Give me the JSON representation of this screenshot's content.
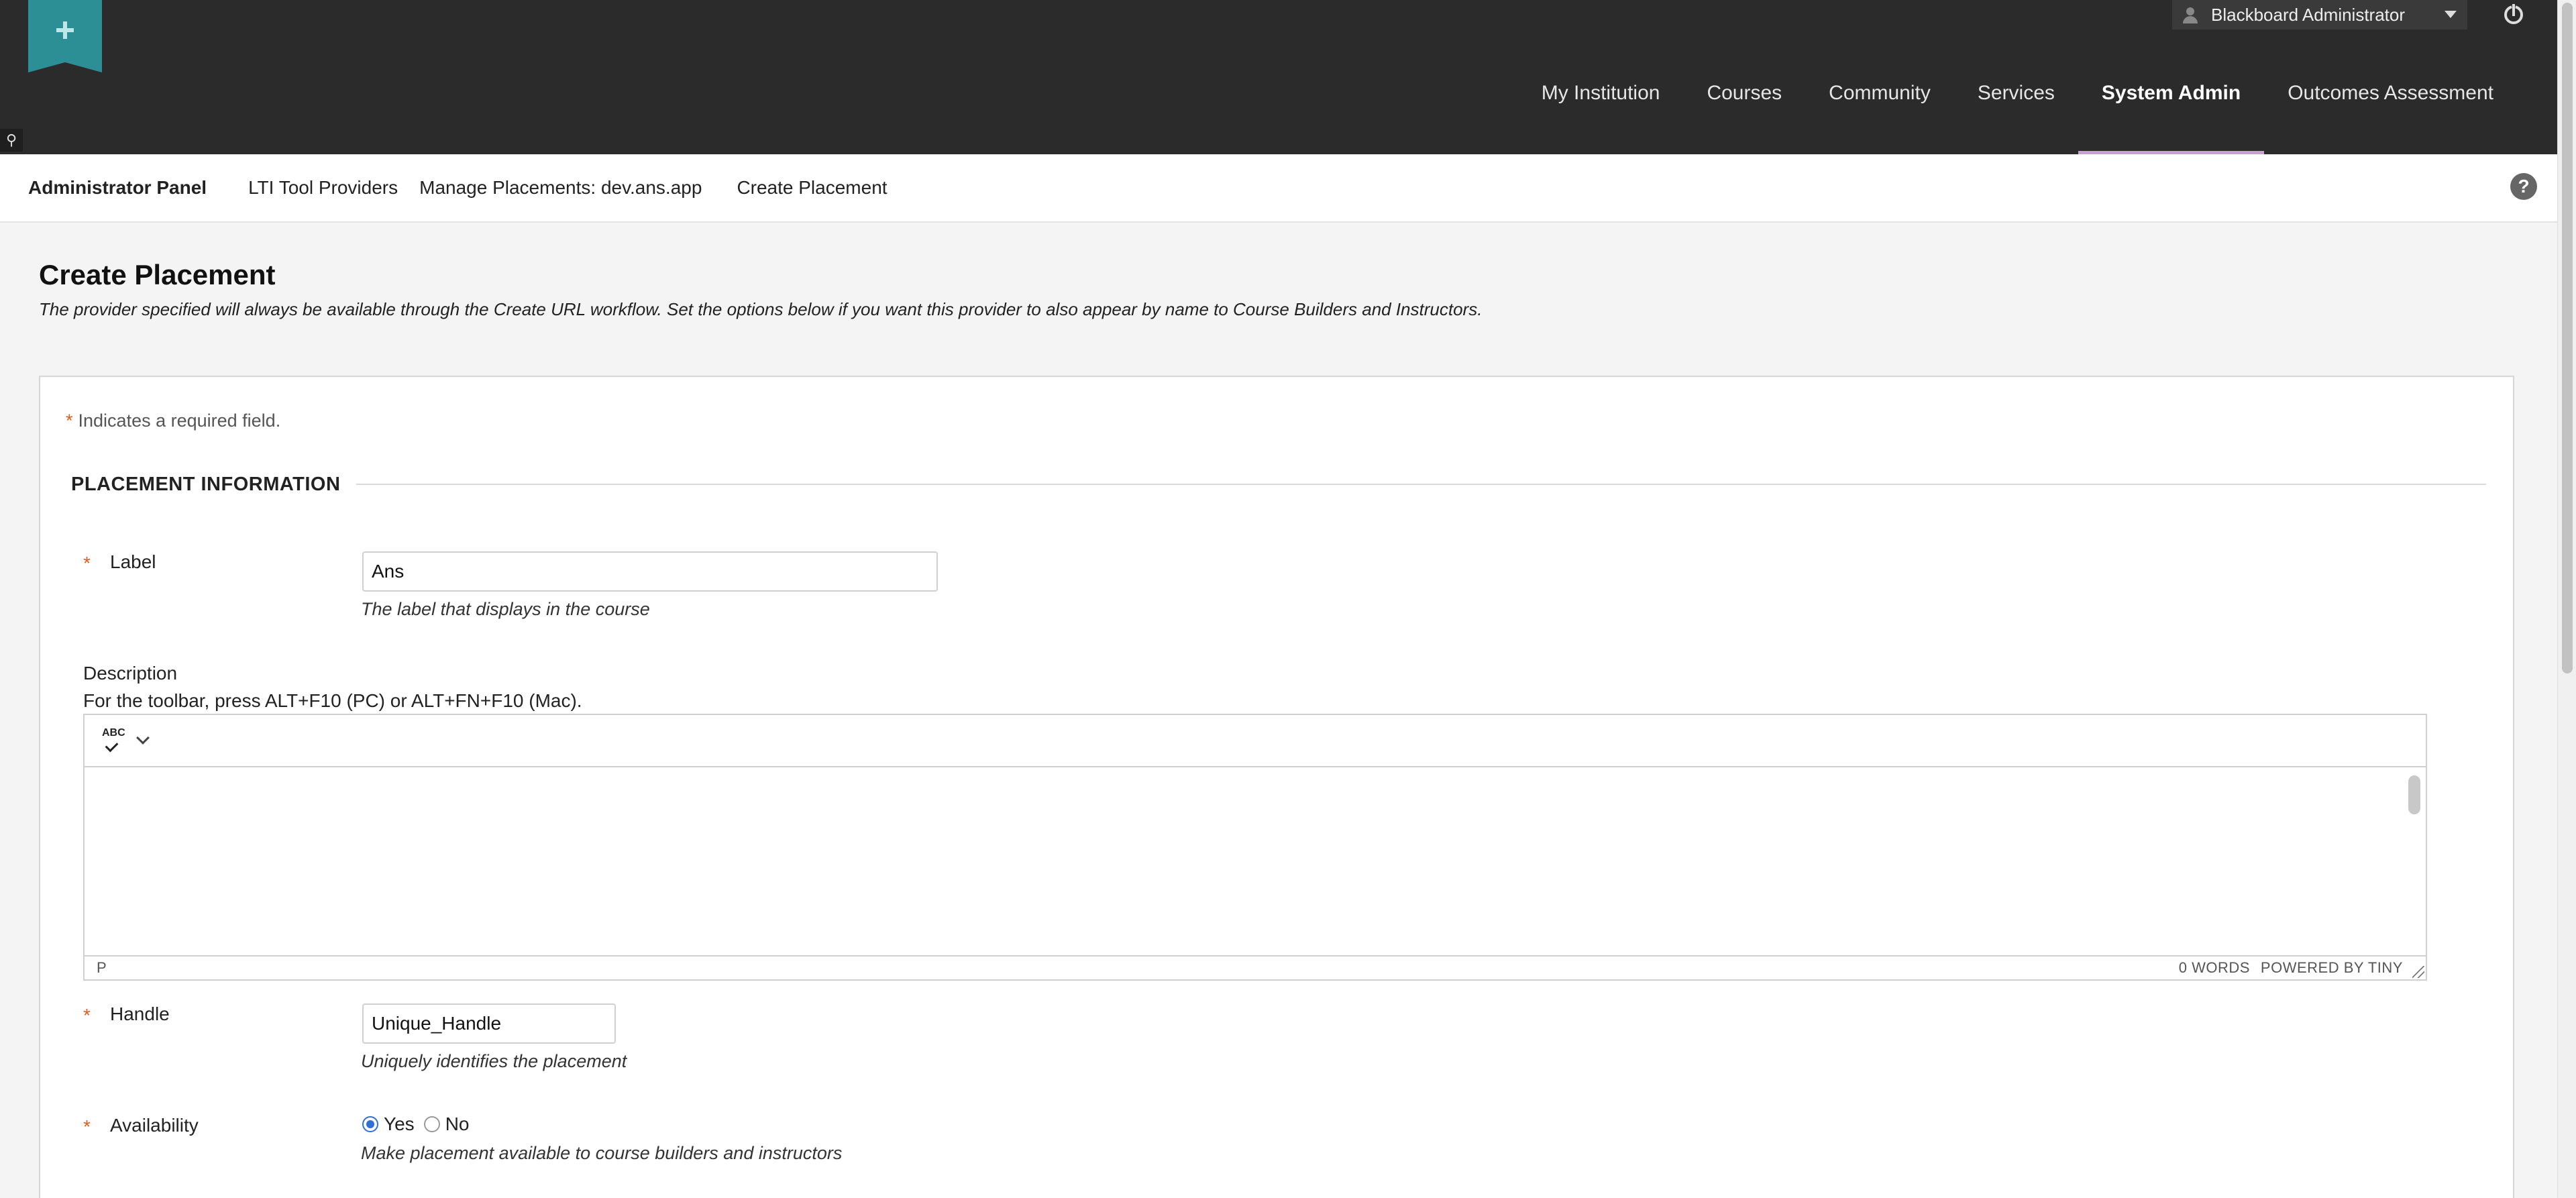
{
  "header": {
    "user": {
      "name": "Blackboard Administrator",
      "icon": "user-icon"
    },
    "power_icon": "power-icon",
    "nav": [
      {
        "label": "My Institution",
        "active": false
      },
      {
        "label": "Courses",
        "active": false
      },
      {
        "label": "Community",
        "active": false
      },
      {
        "label": "Services",
        "active": false
      },
      {
        "label": "System Admin",
        "active": true
      },
      {
        "label": "Outcomes Assessment",
        "active": false
      }
    ]
  },
  "breadcrumb": {
    "items": [
      "Administrator Panel",
      "LTI Tool Providers",
      "Manage Placements: dev.ans.app",
      "Create Placement"
    ],
    "help": "?"
  },
  "page": {
    "title": "Create Placement",
    "subtitle": "The provider specified will always be available through the Create URL workflow. Set the options below if you want this provider to also appear by name to Course Builders and Instructors."
  },
  "form": {
    "required_star": "*",
    "required_note": "Indicates a required field.",
    "section_title": "PLACEMENT INFORMATION",
    "label_field": {
      "label": "Label",
      "value": "Ans",
      "hint": "The label that displays in the course"
    },
    "description": {
      "label": "Description",
      "toolbar_hint": "For the toolbar, press ALT+F10 (PC) or ALT+FN+F10 (Mac).",
      "spell_icon_text": "ABC",
      "status_path": "P",
      "word_count": "0 WORDS",
      "powered_by": "POWERED BY TINY"
    },
    "handle_field": {
      "label": "Handle",
      "value": "Unique_Handle",
      "hint": "Uniquely identifies the placement"
    },
    "availability": {
      "label": "Availability",
      "options": [
        {
          "label": "Yes",
          "checked": true
        },
        {
          "label": "No",
          "checked": false
        }
      ],
      "hint": "Make placement available to course builders and instructors"
    }
  }
}
